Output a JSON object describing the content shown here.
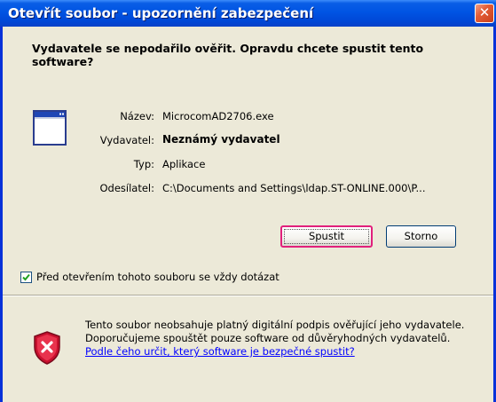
{
  "window": {
    "title": "Otevřít soubor - upozornění zabezpečení",
    "close_symbol": "✕"
  },
  "warning": {
    "heading": "Vydavatele se nepodařilo ověřit. Opravdu chcete spustit tento software?"
  },
  "file_icon": "application-window-icon",
  "properties": {
    "name_label": "Název:",
    "name_value": "MicrocomAD2706.exe",
    "publisher_label": "Vydavatel:",
    "publisher_value": "Neznámý vydavatel",
    "type_label": "Typ:",
    "type_value": "Aplikace",
    "sender_label": "Odesílatel:",
    "sender_value": "C:\\Documents and Settings\\ldap.ST-ONLINE.000\\P..."
  },
  "buttons": {
    "run_label": "Spustit",
    "cancel_label": "Storno"
  },
  "always_ask": {
    "checked": true,
    "label": "Před otevřením tohoto souboru se vždy dotázat"
  },
  "footer": {
    "icon": "security-shield-icon",
    "text": "Tento soubor neobsahuje platný digitální podpis ověřující jeho vydavatele. Doporučujeme spouštět pouze software od důvěryhodných vydavatelů. ",
    "link_text": "Podle čeho určit, který software je bezpečné spustit?"
  },
  "colors": {
    "titlebar": "#0054e3",
    "dialog_background": "#ece9d8",
    "focus_border": "#e1207c",
    "link": "#0000ff",
    "shield_red": "#c8102e"
  }
}
